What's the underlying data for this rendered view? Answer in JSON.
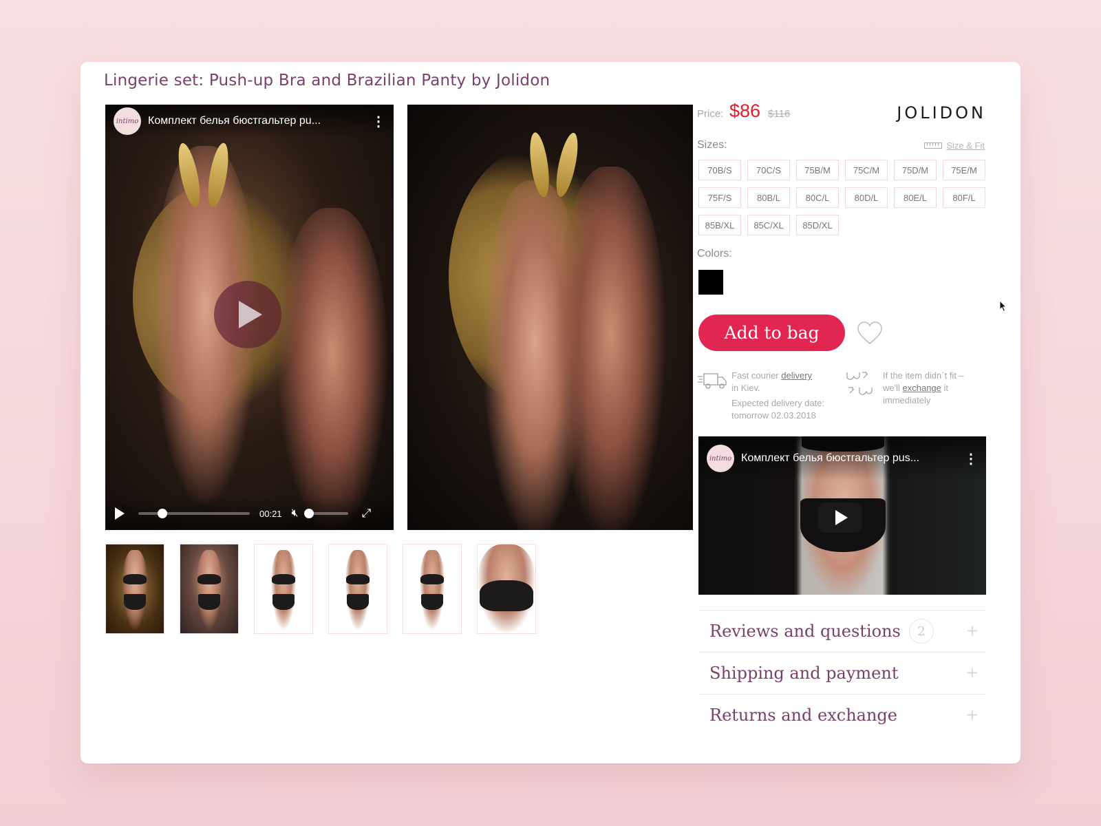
{
  "product": {
    "title": "Lingerie set: Push-up Bra and Brazilian Panty by Jolidon"
  },
  "main_video": {
    "channel_logo": "intimo",
    "title": "Комплект белья бюстгальтер pu...",
    "time": "00:21",
    "progress_fraction": 0.2,
    "volume_fraction": 0.0,
    "muted": true
  },
  "thumbnails": [
    {
      "alt": "Model seated on striped chair"
    },
    {
      "alt": "Model in lace bra, dark backdrop"
    },
    {
      "alt": "Model front view, white background"
    },
    {
      "alt": "Model hands on hips, white background"
    },
    {
      "alt": "Model back view, white background"
    },
    {
      "alt": "Close-up of lace bra"
    }
  ],
  "pricing": {
    "label": "Price:",
    "current": "$86",
    "old": "$116",
    "current_color": "#e8192c"
  },
  "brand": "JOLIDON",
  "sizes": {
    "label": "Sizes:",
    "size_fit_link": "Size & Fit",
    "options": [
      "70B/S",
      "70C/S",
      "75B/M",
      "75C/M",
      "75D/M",
      "75E/M",
      "75F/S",
      "80B/L",
      "80C/L",
      "80D/L",
      "80E/L",
      "80F/L",
      "85B/XL",
      "85C/XL",
      "85D/XL"
    ]
  },
  "colors": {
    "label": "Colors:",
    "options": [
      {
        "name": "black",
        "hex": "#000000"
      }
    ]
  },
  "actions": {
    "add_to_bag": "Add to bag",
    "add_to_bag_color": "#e02651"
  },
  "delivery": {
    "line1_prefix": "Fast courier ",
    "line1_link": "delivery",
    "line2": "in Kiev.",
    "line3": "Expected delivery date:",
    "line4": "tomorrow 02.03.2018"
  },
  "exchange": {
    "line1": "If the item didn`t fit –",
    "line2_prefix": "we'll ",
    "line2_link": "exchange",
    "line2_suffix": " it",
    "line3": "immediately"
  },
  "secondary_video": {
    "channel_logo": "intimo",
    "title": "Комплект белья бюстгальтер pus..."
  },
  "accordion": [
    {
      "title": "Reviews and questions",
      "badge": "2"
    },
    {
      "title": "Shipping and payment"
    },
    {
      "title": "Returns and exchange"
    }
  ]
}
